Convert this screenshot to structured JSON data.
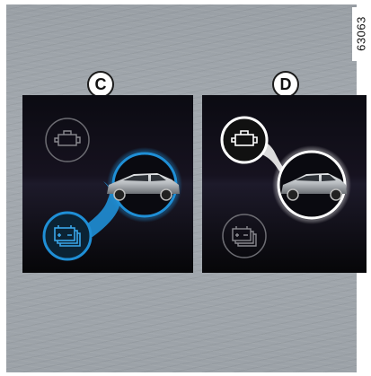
{
  "figure_code": "63063",
  "panels": [
    {
      "letter": "C",
      "active_icon": "battery",
      "accent": "#1f8fd6"
    },
    {
      "letter": "D",
      "active_icon": "engine",
      "accent": "#ffffff"
    }
  ]
}
